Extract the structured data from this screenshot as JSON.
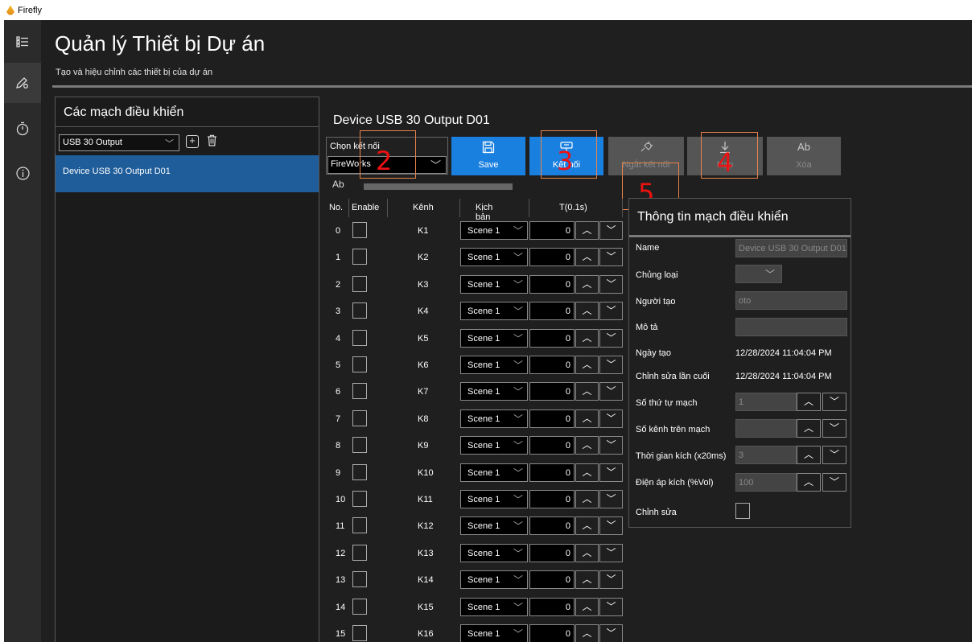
{
  "titlebar": {
    "app_name": "Firefly"
  },
  "nav": {
    "menu_icon": "list-icon",
    "edit_icon": "edit-device-icon",
    "timer_icon": "stopwatch-icon",
    "info_icon": "info-icon"
  },
  "header": {
    "title": "Quản lý Thiết bị Dự án",
    "subtitle": "Tạo và hiệu chỉnh các thiết bị của dự án"
  },
  "controllers": {
    "title": "Các mạch điều khiển",
    "type_select": "USB 30 Output",
    "items": [
      "Device USB 30 Output D01"
    ]
  },
  "device": {
    "title": "Device USB 30 Output D01",
    "connection_label": "Chọn kết nối",
    "connection_value": "FireWorks"
  },
  "toolbar": {
    "save": "Save",
    "connect": "Kết nối",
    "disconnect": "Ngắt kết nối",
    "download": "Nạp",
    "delete": "Xóa"
  },
  "grid": {
    "headers": {
      "no": "No.",
      "enable": "Enable",
      "channel": "Kênh",
      "scene": "Kịch bản",
      "time": "T(0.1s)"
    },
    "rows": [
      {
        "no": "0",
        "channel": "K1",
        "scene": "Scene 1",
        "time": "0"
      },
      {
        "no": "1",
        "channel": "K2",
        "scene": "Scene 1",
        "time": "0"
      },
      {
        "no": "2",
        "channel": "K3",
        "scene": "Scene 1",
        "time": "0"
      },
      {
        "no": "3",
        "channel": "K4",
        "scene": "Scene 1",
        "time": "0"
      },
      {
        "no": "4",
        "channel": "K5",
        "scene": "Scene 1",
        "time": "0"
      },
      {
        "no": "5",
        "channel": "K6",
        "scene": "Scene 1",
        "time": "0"
      },
      {
        "no": "6",
        "channel": "K7",
        "scene": "Scene 1",
        "time": "0"
      },
      {
        "no": "7",
        "channel": "K8",
        "scene": "Scene 1",
        "time": "0"
      },
      {
        "no": "8",
        "channel": "K9",
        "scene": "Scene 1",
        "time": "0"
      },
      {
        "no": "9",
        "channel": "K10",
        "scene": "Scene 1",
        "time": "0"
      },
      {
        "no": "10",
        "channel": "K11",
        "scene": "Scene 1",
        "time": "0"
      },
      {
        "no": "11",
        "channel": "K12",
        "scene": "Scene 1",
        "time": "0"
      },
      {
        "no": "12",
        "channel": "K13",
        "scene": "Scene 1",
        "time": "0"
      },
      {
        "no": "13",
        "channel": "K14",
        "scene": "Scene 1",
        "time": "0"
      },
      {
        "no": "14",
        "channel": "K15",
        "scene": "Scene 1",
        "time": "0"
      },
      {
        "no": "15",
        "channel": "K16",
        "scene": "Scene 1",
        "time": "0"
      }
    ]
  },
  "info": {
    "title": "Thông tin mạch điều khiển",
    "name_label": "Name",
    "name_value": "Device USB 30 Output D01",
    "type_label": "Chủng loại",
    "creator_label": "Người tạo",
    "creator_value": "oto",
    "desc_label": "Mô tả",
    "desc_value": "",
    "created_label": "Ngày tạo",
    "created_value": "12/28/2024 11:04:04 PM",
    "modified_label": "Chỉnh sửa lần cuối",
    "modified_value": "12/28/2024 11:04:04 PM",
    "order_label": "Số thứ tự mạch",
    "order_value": "1",
    "channels_label": "Số kênh trên mạch",
    "channels_value": "",
    "trigger_time_label": "Thời gian kích (x20ms)",
    "trigger_time_value": "3",
    "voltage_label": "Điện áp kích (%Vol)",
    "voltage_value": "100",
    "edit_label": "Chỉnh sửa"
  },
  "annotations": {
    "n2": "2",
    "n3": "3",
    "n4": "4",
    "n5": "5",
    "color": "#e8834a",
    "num_color": "#ee1111"
  }
}
